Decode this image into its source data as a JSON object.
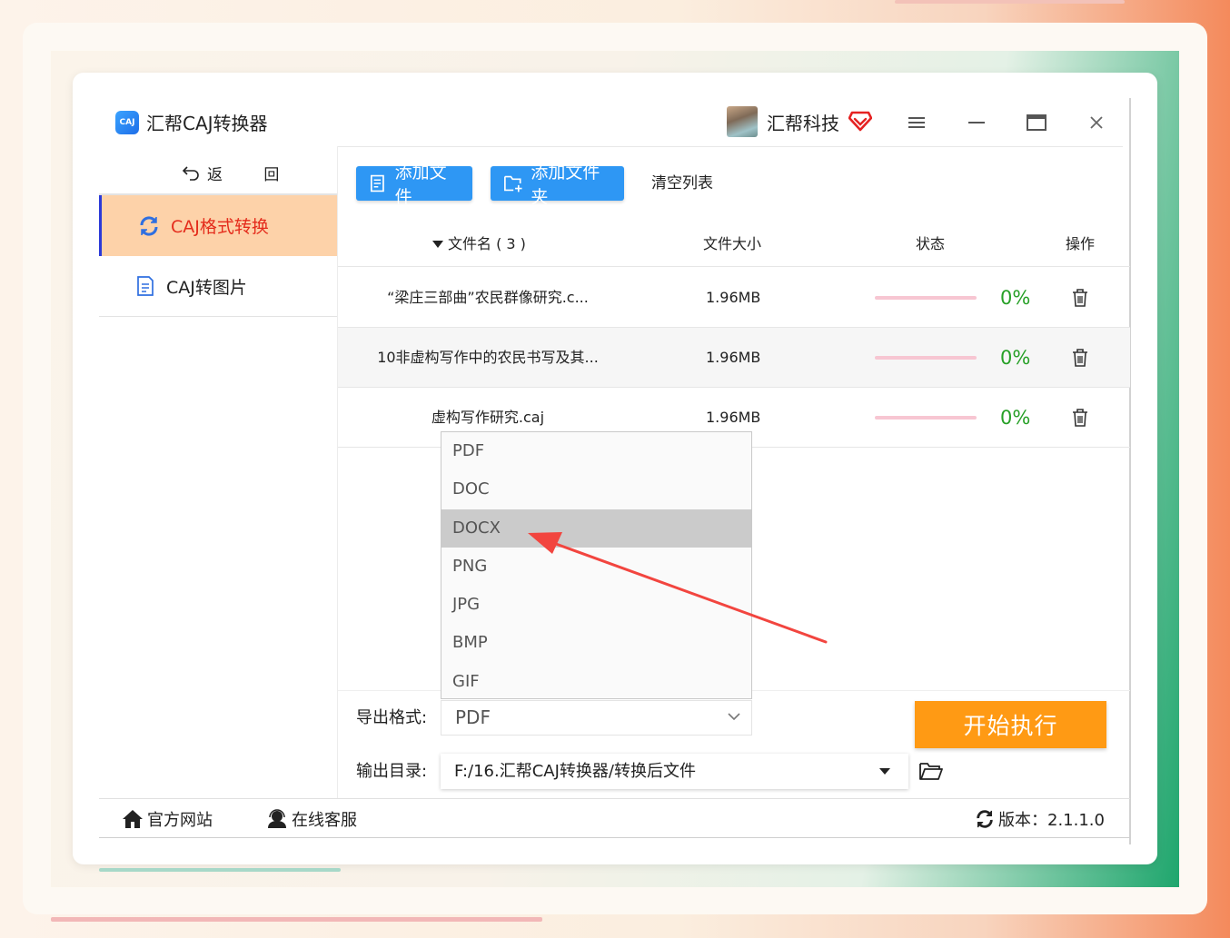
{
  "app": {
    "title": "汇帮CAJ转换器",
    "logo_text": "CAJ",
    "user_name": "汇帮科技",
    "version_label": "版本：2.1.1.0"
  },
  "sidebar": {
    "back_label": "返 回",
    "items": [
      {
        "label": "CAJ格式转换",
        "icon": "refresh-icon",
        "active": true
      },
      {
        "label": "CAJ转图片",
        "icon": "document-icon",
        "active": false
      }
    ]
  },
  "toolbar": {
    "add_file": "添加文件",
    "add_folder": "添加文件夹",
    "clear_list": "清空列表"
  },
  "table": {
    "columns": {
      "name": "文件名 ( 3 )",
      "size": "文件大小",
      "status": "状态",
      "action": "操作"
    },
    "rows": [
      {
        "name": "“梁庄三部曲”农民群像研究.c...",
        "size": "1.96MB",
        "progress": "0%"
      },
      {
        "name": "10非虚构写作中的农民书写及其...",
        "size": "1.96MB",
        "progress": "0%"
      },
      {
        "name": "虚构写作研究.caj",
        "size": "1.96MB",
        "progress": "0%"
      }
    ]
  },
  "format_dropdown": {
    "options": [
      "PDF",
      "DOC",
      "DOCX",
      "PNG",
      "JPG",
      "BMP",
      "GIF"
    ],
    "highlighted": "DOCX"
  },
  "output": {
    "format_label": "导出格式:",
    "format_value": "PDF",
    "dir_label": "输出目录:",
    "dir_value": "F:/16.汇帮CAJ转换器/转换后文件"
  },
  "actions": {
    "start": "开始执行"
  },
  "footer": {
    "official_site": "官方网站",
    "online_service": "在线客服"
  },
  "colors": {
    "accent_blue": "#2e97f4",
    "start_orange": "#ff9a14",
    "active_nav_bg": "#fdd2a9",
    "active_nav_text": "#e42c1c",
    "progress_green": "#27a027",
    "annotation_arrow": "#f2453f"
  }
}
